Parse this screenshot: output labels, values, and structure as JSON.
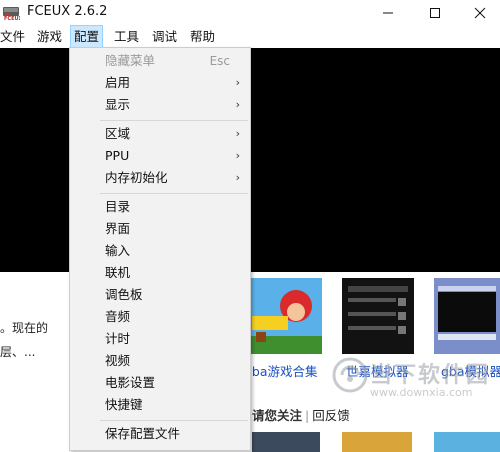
{
  "window": {
    "title": "FCEUX 2.6.2"
  },
  "menubar": [
    {
      "label": "文件",
      "active": false
    },
    {
      "label": "游戏",
      "active": false
    },
    {
      "label": "配置",
      "active": true
    },
    {
      "label": "工具",
      "active": false
    },
    {
      "label": "调试",
      "active": false
    },
    {
      "label": "帮助",
      "active": false
    }
  ],
  "config_menu": {
    "items": [
      {
        "label": "隐藏菜单",
        "shortcut": "Esc",
        "disabled": true
      },
      {
        "label": "启用",
        "submenu": true
      },
      {
        "label": "显示",
        "submenu": true
      },
      {
        "separator": true
      },
      {
        "label": "区域",
        "submenu": true
      },
      {
        "label": "PPU",
        "submenu": true
      },
      {
        "label": "内存初始化",
        "submenu": true
      },
      {
        "separator": true
      },
      {
        "label": "目录"
      },
      {
        "label": "界面"
      },
      {
        "label": "输入"
      },
      {
        "label": "联机"
      },
      {
        "label": "调色板"
      },
      {
        "label": "音频"
      },
      {
        "label": "计时"
      },
      {
        "label": "视频"
      },
      {
        "label": "电影设置"
      },
      {
        "label": "快捷键"
      },
      {
        "separator": true
      },
      {
        "label": "保存配置文件"
      }
    ]
  },
  "web": {
    "snippet_lines": [
      "。现在的",
      "层、..."
    ],
    "thumbnails": [
      {
        "caption": "gba游戏合集"
      },
      {
        "caption": "世嘉模拟器"
      },
      {
        "caption": "gba模拟器"
      }
    ],
    "follow_text": "请您关注",
    "feedback_text": "回反馈"
  },
  "watermark": {
    "name": "当下软件园",
    "url": "www.downxia.com"
  },
  "colors": {
    "menu_bg": "#f2f2f2",
    "active_menu": "#cce8ff",
    "link": "#1a4fc2",
    "emulator_bg": "#000000"
  }
}
